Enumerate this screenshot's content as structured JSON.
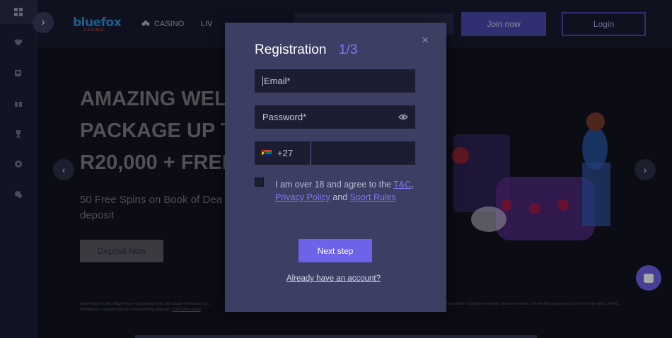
{
  "header": {
    "logo_main": "bluefox",
    "logo_sub": "CASINO",
    "nav_casino": "CASINO",
    "nav_live": "LIV",
    "join_label": "Join now",
    "login_label": "Login"
  },
  "hero": {
    "title": "AMAZING WELC PACKAGE UP T R20,000 + FREE",
    "subtitle": "50 Free Spins on Book of Dea first deposit",
    "deposit_label": "Deposit Now",
    "fine_print_left": "New Players Only. Wager from real balance first. 50X wager the bonus. Co... Withdrawal requests void all active/pending bonuses.",
    "fine_print_link": "Full Terms apply",
    "fine_print_right": "spins valid 7 days from receipt. Max conversion: 3 times the bonus amount or from free spins: R400."
  },
  "modal": {
    "title": "Registration",
    "step": "1/3",
    "email_placeholder": "Email*",
    "password_placeholder": "Password*",
    "phone_code": "+27",
    "terms_prefix": "I am over 18 and agree to the",
    "terms_tc": "T&C",
    "terms_comma": ",",
    "terms_privacy": "Privacy Policy",
    "terms_and": "and",
    "terms_sport": "Sport Rules",
    "next_label": "Next step",
    "already_label": "Already have an account?"
  },
  "colors": {
    "accent": "#6c63e8",
    "modal_bg": "#3c3f63",
    "field_bg": "#1c1d31"
  }
}
